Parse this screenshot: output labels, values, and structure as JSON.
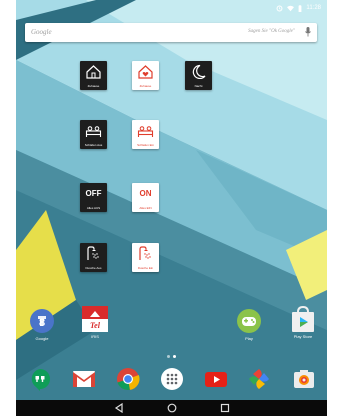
{
  "status_bar": {
    "time": "11:28",
    "icons": [
      "alarm-icon",
      "wifi-icon",
      "battery-icon"
    ]
  },
  "search_bar": {
    "brand": "Google",
    "hint": "Sagen Sie \"Ok Google\"",
    "icon": "mic-icon"
  },
  "widgets": [
    {
      "kind": "icon",
      "icon": "home-outline-icon",
      "label": "Zuhause",
      "theme": "dark"
    },
    {
      "kind": "icon",
      "icon": "home-heart-icon",
      "label": "Zuhause",
      "theme": "light"
    },
    {
      "kind": "icon",
      "icon": "moon-icon",
      "label": "Nacht",
      "theme": "dark"
    },
    {
      "kind": "icon",
      "icon": "bed-icon",
      "label": "Schlafen Aus",
      "theme": "dark"
    },
    {
      "kind": "icon",
      "icon": "bed-icon",
      "label": "Schlafen Ein",
      "theme": "light"
    },
    {
      "kind": "text",
      "text": "OFF",
      "label": "Alles AUS",
      "theme": "dark"
    },
    {
      "kind": "text",
      "text": "ON",
      "label": "Alles EIN",
      "theme": "light"
    },
    {
      "kind": "icon",
      "icon": "shower-icon",
      "label": "Dusche Aus",
      "theme": "dark"
    },
    {
      "kind": "icon",
      "icon": "shower-icon",
      "label": "Dusche Ein",
      "theme": "light"
    }
  ],
  "apps": [
    {
      "label": "Google",
      "icon": "google-plus-icon"
    },
    {
      "label": "IRIS",
      "icon": "iris-logo-icon"
    },
    {
      "label": "Play",
      "icon": "games-controller-icon"
    },
    {
      "label": "Play Store",
      "icon": "play-store-icon"
    }
  ],
  "dock": [
    "hangouts-icon",
    "gmail-icon",
    "chrome-icon",
    "app-drawer-icon",
    "youtube-icon",
    "photos-icon",
    "camera-icon"
  ],
  "page_indicator": {
    "count": 2,
    "active": 1
  },
  "nav_bar": [
    "back-icon",
    "home-icon",
    "recents-icon"
  ],
  "colors": {
    "dark_widget": "#1e1e1e",
    "light_widget_accent": "#e03e2d",
    "dock_bar": "#0a0a0a"
  }
}
